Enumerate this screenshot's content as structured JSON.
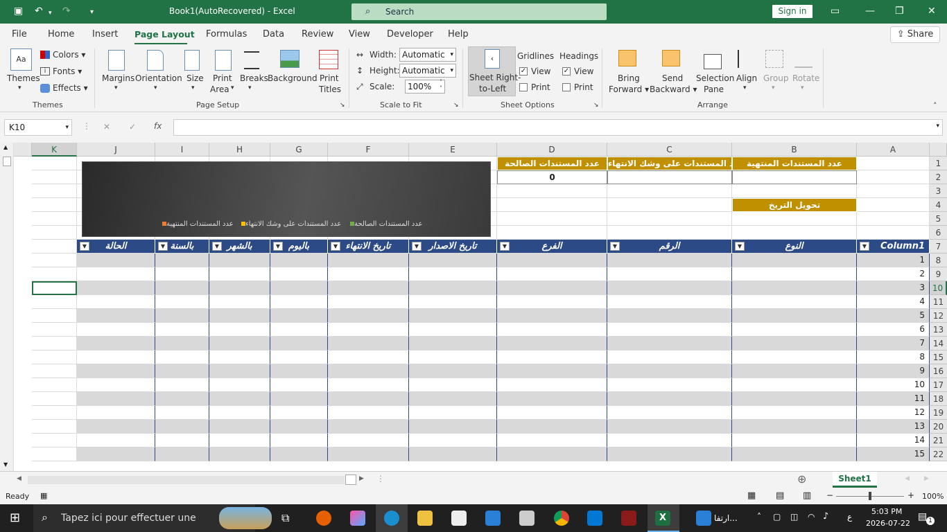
{
  "window": {
    "title": "Book1(AutoRecovered)  -  Excel",
    "search_label": "Search",
    "signin_label": "Sign in"
  },
  "menu": {
    "items": [
      "File",
      "Home",
      "Insert",
      "Page Layout",
      "Formulas",
      "Data",
      "Review",
      "View",
      "Developer",
      "Help"
    ],
    "active": "Page Layout",
    "share_label": "Share"
  },
  "ribbon": {
    "themes": {
      "themes_label": "Themes",
      "colors_label": "Colors",
      "fonts_label": "Fonts",
      "effects_label": "Effects",
      "group_label": "Themes"
    },
    "page_setup": {
      "margins": "Margins",
      "orientation": "Orientation",
      "size": "Size",
      "print_area_1": "Print",
      "print_area_2": "Area",
      "breaks": "Breaks",
      "background": "Background",
      "print_titles_1": "Print",
      "print_titles_2": "Titles",
      "group_label": "Page Setup"
    },
    "scale_to_fit": {
      "width_label": "Width:",
      "width_value": "Automatic",
      "height_label": "Height:",
      "height_value": "Automatic",
      "scale_label": "Scale:",
      "scale_value": "100%",
      "group_label": "Scale to Fit"
    },
    "sheet_options": {
      "rtl_1": "Sheet Right-",
      "rtl_2": "to-Left",
      "gridlines": "Gridlines",
      "headings": "Headings",
      "grid_view": "View",
      "grid_print": "Print",
      "head_view": "View",
      "head_print": "Print",
      "group_label": "Sheet Options"
    },
    "arrange": {
      "bring_1": "Bring",
      "bring_2": "Forward",
      "send_1": "Send",
      "send_2": "Backward",
      "sel_1": "Selection",
      "sel_2": "Pane",
      "align": "Align",
      "group": "Group",
      "rotate": "Rotate",
      "group_label": "Arrange"
    }
  },
  "formula_bar": {
    "name_box": "K10",
    "fx_label": "fx",
    "formula": ""
  },
  "grid": {
    "columns": [
      "K",
      "J",
      "I",
      "H",
      "G",
      "F",
      "E",
      "D",
      "C",
      "B",
      "A"
    ],
    "rows": [
      "1",
      "2",
      "3",
      "4",
      "5",
      "6",
      "7",
      "8",
      "9",
      "10",
      "11",
      "12",
      "13",
      "14",
      "15",
      "16",
      "17",
      "18",
      "19",
      "20",
      "21",
      "22"
    ],
    "d1": "عدد المستندات الصالحة",
    "c1": "عدد المستندات على وشك الانتهاء",
    "b1": "عدد المستندات المنتهية",
    "d2": "0",
    "b4": "تحويل التريخ",
    "table_headers": [
      "Column1",
      "النوع",
      "الرقم",
      "الفرع",
      "تاريخ الاصدار",
      "تاريخ الانتهاء",
      "باليوم",
      "بالشهر",
      "بالسنة",
      "الحالة"
    ],
    "row_numbers": [
      "1",
      "2",
      "3",
      "4",
      "5",
      "6",
      "7",
      "8",
      "9",
      "10",
      "11",
      "12",
      "13",
      "14",
      "15"
    ]
  },
  "chart_data": {
    "type": "bar",
    "categories": [],
    "series": [
      {
        "name": "عدد المستندات الصالحة",
        "values": [],
        "color": "#70ad47"
      },
      {
        "name": "عدد المستندات على وشك الانتهاء",
        "values": [],
        "color": "#ffc000"
      },
      {
        "name": "عدد المستندات المنتهية",
        "values": [],
        "color": "#ed7d31"
      }
    ],
    "title": "",
    "legend": "bottom"
  },
  "sheets": {
    "active": "Sheet1"
  },
  "status": {
    "ready": "Ready",
    "zoom": "100%"
  },
  "taskbar": {
    "search_placeholder": "Tapez ici pour effectuer une",
    "time": "5:03 PM",
    "date": "2026-07-22",
    "notif_count": "1",
    "lang": "ع",
    "app_label": "ارتفا..."
  }
}
